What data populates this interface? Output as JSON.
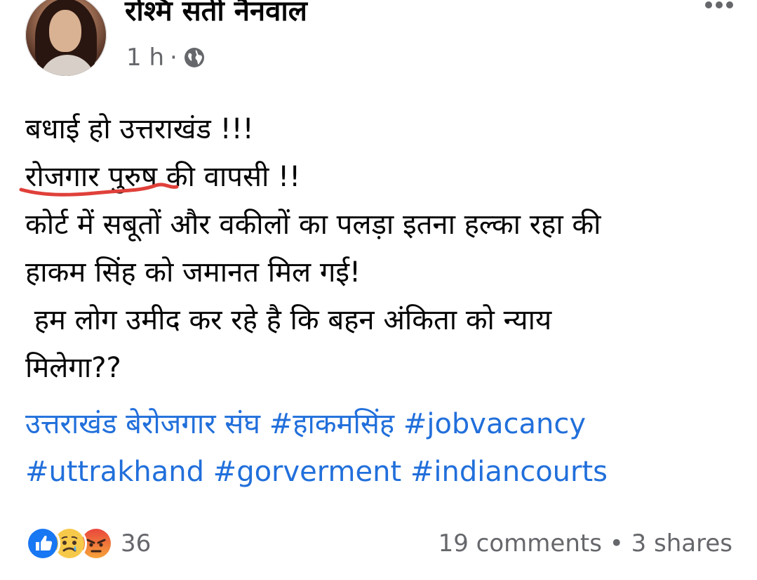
{
  "post": {
    "author": "रश्मि सती नैनवाल",
    "time": "1 h",
    "separator": "·",
    "audience_icon": "globe-icon",
    "more_icon": "more-options-icon",
    "lines": {
      "l1": "बधाई हो उत्तराखंड !!!",
      "l2a": "रोजगार पुरुष",
      "l2b": " की वापसी !!",
      "l3": "कोर्ट में सबूतों और वकीलों का  पलड़ा इतना हल्का रहा की",
      "l4": "हाकम सिंह को जमानत मिल गई!",
      "l5": " हम लोग उमीद कर रहे है कि बहन अंकिता को न्याय",
      "l6": "मिलेगा??"
    },
    "hashtags": {
      "line1": "उत्तराखंड बेरोजगार संघ #हाकमसिंह #jobvacancy",
      "line2": "#uttrakhand #gorverment #indiancourts"
    }
  },
  "footer": {
    "reactions": [
      "like-icon",
      "sad-icon",
      "angry-icon"
    ],
    "reaction_count": "36",
    "stats": "19 comments • 3 shares"
  },
  "colors": {
    "link": "#216fdb",
    "secondary_text": "#65676b",
    "like_blue": "#1877f2",
    "underline_red": "#e0403a"
  }
}
